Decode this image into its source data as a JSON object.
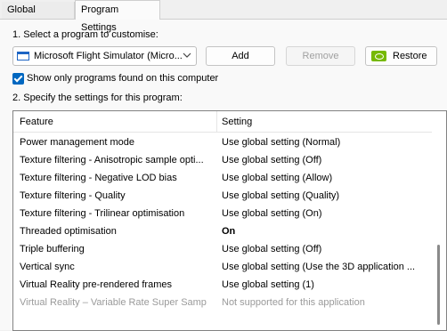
{
  "tabs": [
    {
      "label": "Global Settings"
    },
    {
      "label": "Program Settings"
    }
  ],
  "step1_label": "1. Select a program to customise:",
  "program_select": {
    "value": "Microsoft Flight Simulator (Micro..."
  },
  "buttons": {
    "add": "Add",
    "remove": "Remove",
    "restore": "Restore"
  },
  "show_only_checkbox": {
    "label": "Show only programs found on this computer",
    "checked": true
  },
  "step2_label": "2. Specify the settings for this program:",
  "table": {
    "headers": {
      "feature": "Feature",
      "setting": "Setting"
    },
    "rows": [
      {
        "feature": "Power management mode",
        "setting": "Use global setting (Normal)"
      },
      {
        "feature": "Texture filtering - Anisotropic sample opti...",
        "setting": "Use global setting (Off)"
      },
      {
        "feature": "Texture filtering - Negative LOD bias",
        "setting": "Use global setting (Allow)"
      },
      {
        "feature": "Texture filtering - Quality",
        "setting": "Use global setting (Quality)"
      },
      {
        "feature": "Texture filtering - Trilinear optimisation",
        "setting": "Use global setting (On)"
      },
      {
        "feature": "Threaded optimisation",
        "setting": "On"
      },
      {
        "feature": "Triple buffering",
        "setting": "Use global setting (Off)"
      },
      {
        "feature": "Vertical sync",
        "setting": "Use global setting (Use the 3D application ..."
      },
      {
        "feature": "Virtual Reality pre-rendered frames",
        "setting": "Use global setting (1)"
      },
      {
        "feature": "Virtual Reality – Variable Rate Super Samp...",
        "setting": "Not supported for this application"
      }
    ]
  },
  "colors": {
    "accent": "#0067c0",
    "nvidia_green": "#76b900"
  }
}
